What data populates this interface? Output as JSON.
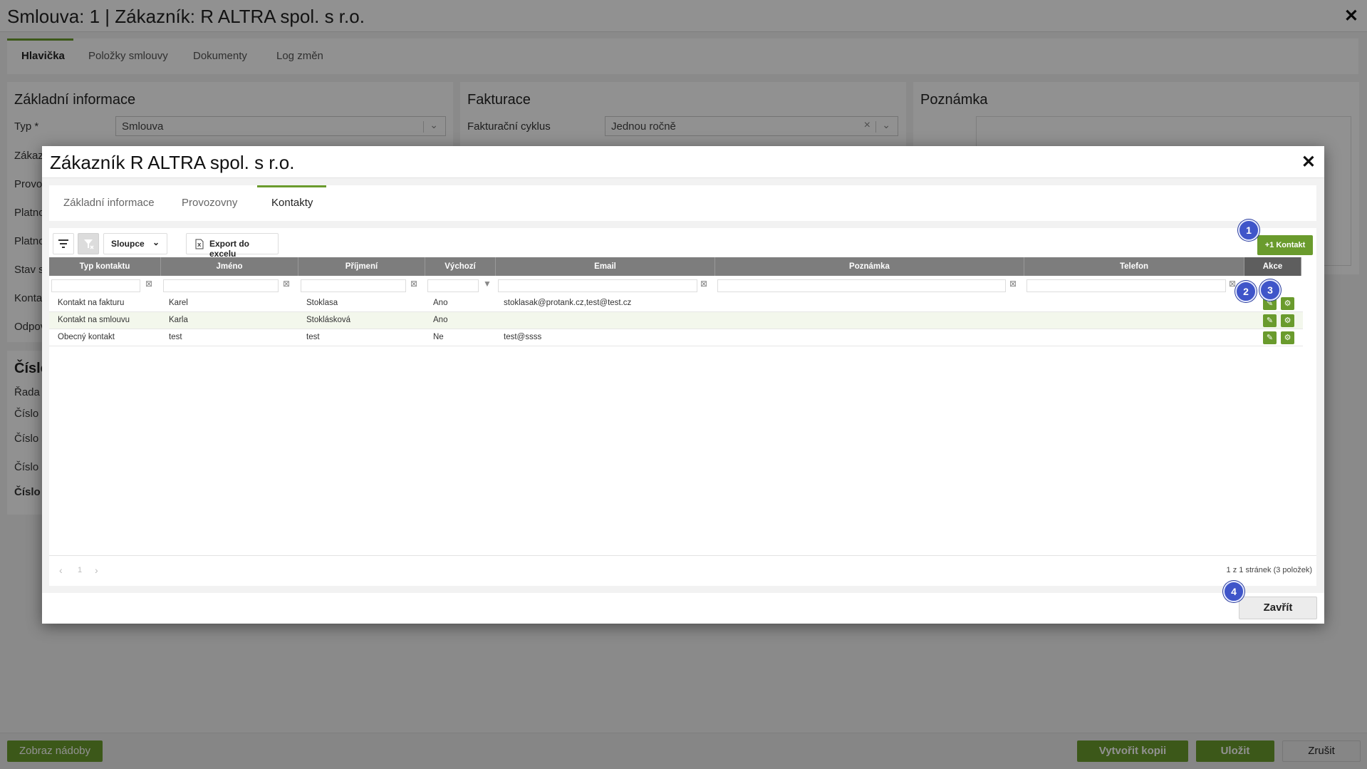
{
  "page": {
    "title": "Smlouva: 1 | Zákazník: R ALTRA spol. s r.o.",
    "close_glyph": "✕",
    "tabs": [
      "Hlavička",
      "Položky smlouvy",
      "Dokumenty",
      "Log změn"
    ],
    "panels": {
      "zakladni": {
        "title": "Základní informace",
        "typ_label": "Typ *",
        "typ_value": "Smlouva",
        "partial_labels": [
          "Zákaz",
          "Provo",
          "Platno",
          "Platno",
          "Stav s",
          "Konta",
          "Odpov"
        ]
      },
      "fakturace": {
        "title": "Fakturace",
        "cyklus_label": "Fakturační cyklus",
        "cyklus_value": "Jednou ročně"
      },
      "poznamka": {
        "title": "Poznámka"
      },
      "cislo": {
        "title": "Číslo",
        "partial_labels": [
          "Řada s",
          "Číslo",
          "Číslo s",
          "Číslo c",
          "Číslo c"
        ]
      }
    },
    "bottom": {
      "show_containers": "Zobraz nádoby",
      "create_copy": "Vytvořit kopii",
      "save": "Uložit",
      "cancel": "Zrušit"
    }
  },
  "modal": {
    "title": "Zákazník R ALTRA spol. s r.o.",
    "close_glyph": "✕",
    "tabs": [
      "Základní informace",
      "Provozovny",
      "Kontakty"
    ],
    "toolbar": {
      "columns_label": "Sloupce",
      "export_label": "Export do excelu",
      "add_contact_label": "+1 Kontakt"
    },
    "columns": [
      "Typ kontaktu",
      "Jméno",
      "Příjmení",
      "Výchozí",
      "Email",
      "Poznámka",
      "Telefon",
      "Akce"
    ],
    "rows": [
      [
        "Kontakt na fakturu",
        "Karel",
        "Stoklasa",
        "Ano",
        "stoklasak@protank.cz,test@test.cz",
        "",
        ""
      ],
      [
        "Kontakt na smlouvu",
        "Karla",
        "Stoklásková",
        "Ano",
        "",
        "",
        ""
      ],
      [
        "Obecný kontakt",
        "test",
        "test",
        "Ne",
        "test@ssss",
        "",
        ""
      ]
    ],
    "pager": {
      "prev": "‹",
      "page": "1",
      "next": "›",
      "info": "1 z 1 stránek (3 položek)"
    },
    "footer": {
      "close_label": "Zavřít"
    }
  },
  "markers": [
    "1",
    "2",
    "3",
    "4"
  ],
  "colors": {
    "accent_green": "#6a9b2d",
    "header_gray": "#7d7d7d",
    "marker_blue": "#3f55c9"
  }
}
